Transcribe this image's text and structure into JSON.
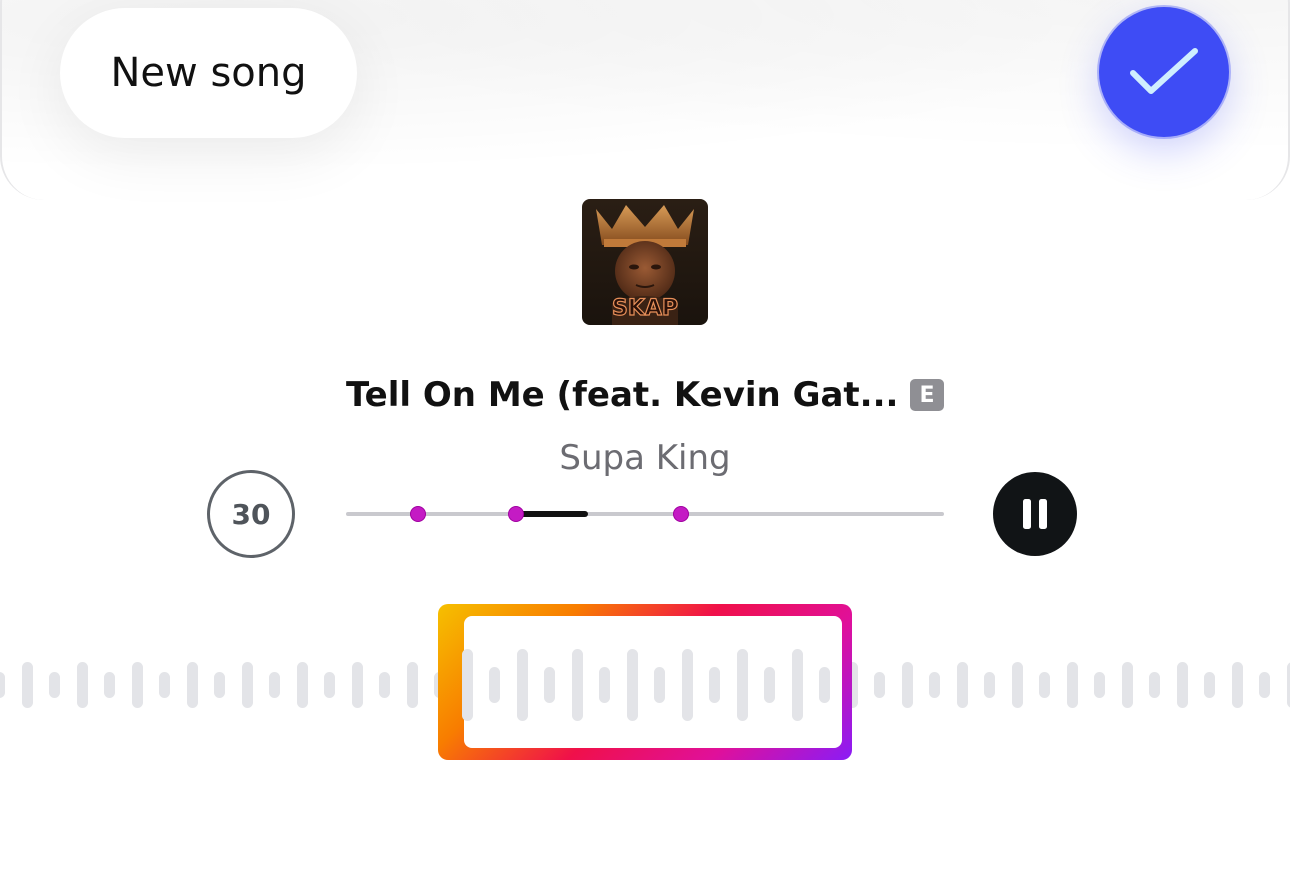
{
  "header": {
    "new_song_label": "New song",
    "confirm_icon": "checkmark-icon",
    "accent_color": "#3e4cf5"
  },
  "track": {
    "title": "Tell On Me (feat. Kevin Gat...",
    "explicit_badge": "E",
    "artist": "Supa King",
    "album_art_text": "SKAP"
  },
  "controls": {
    "duration_label": "30",
    "pause_icon": "pause-icon",
    "marker_color": "#c41bc4"
  },
  "scrubber": {
    "markers": [
      0.12,
      0.285,
      0.56
    ],
    "selection": [
      0.285,
      0.405
    ]
  },
  "clip_selector": {
    "gradient": [
      "#f6c000",
      "#f87d00",
      "#f0104a",
      "#e0109a",
      "#8a1cf6"
    ]
  }
}
